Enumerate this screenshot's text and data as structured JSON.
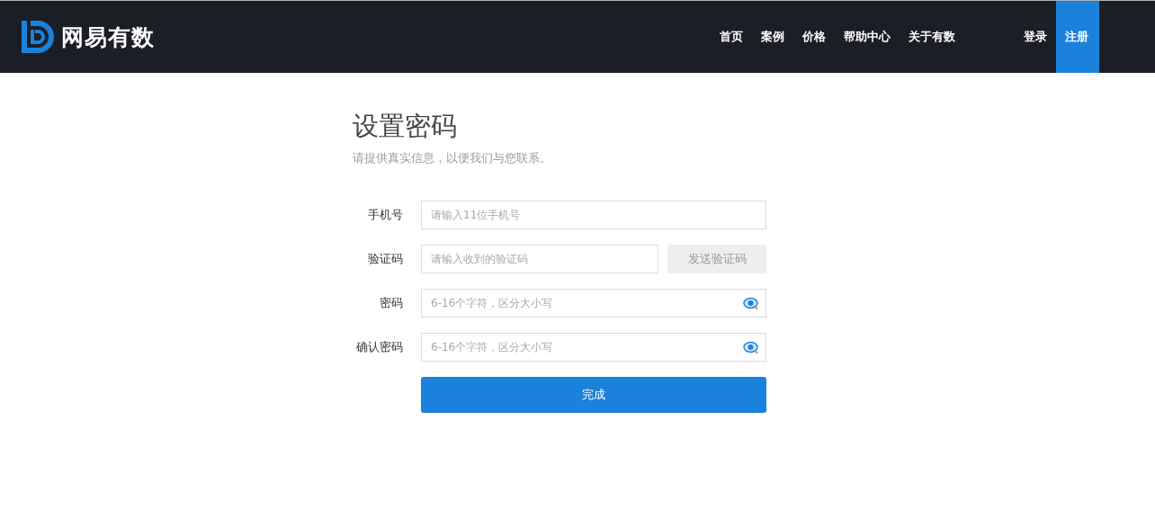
{
  "header": {
    "brand": "网易有数",
    "nav": [
      {
        "label": "首页"
      },
      {
        "label": "案例"
      },
      {
        "label": "价格"
      },
      {
        "label": "帮助中心"
      },
      {
        "label": "关于有数"
      }
    ],
    "account": [
      {
        "label": "登录",
        "kind": "plain"
      },
      {
        "label": "注册",
        "kind": "primary"
      }
    ]
  },
  "form": {
    "title": "设置密码",
    "subtitle": "请提供真实信息，以便我们与您联系。",
    "fields": [
      {
        "label": "手机号",
        "placeholder": "请输入11位手机号",
        "kind": "text"
      },
      {
        "label": "验证码",
        "placeholder": "请输入收到的验证码",
        "kind": "code",
        "action": "发送验证码",
        "disabled": true
      },
      {
        "label": "密码",
        "placeholder": "6-16个字符，区分大小写",
        "kind": "password"
      },
      {
        "label": "确认密码",
        "placeholder": "6-16个字符，区分大小写",
        "kind": "password"
      }
    ],
    "submit": "完成"
  }
}
